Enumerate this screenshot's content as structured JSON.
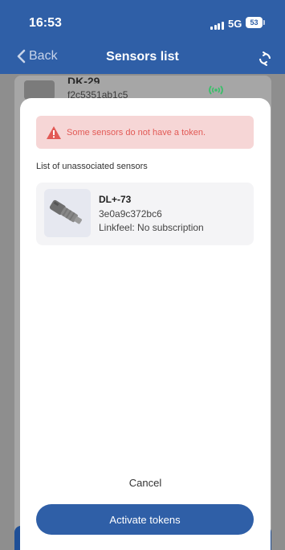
{
  "status_bar": {
    "time": "16:53",
    "network": "5G",
    "battery": "53"
  },
  "nav": {
    "back_label": "Back",
    "title": "Sensors list"
  },
  "background_item": {
    "name": "DK-29",
    "id": "f2c5351ab1c5"
  },
  "modal": {
    "alert_text": "Some sensors do not have a token.",
    "section_label": "List of unassociated sensors",
    "sensors": [
      {
        "name": "DL+-73",
        "id": "3e0a9c372bc6",
        "subscription": "Linkfeel: No subscription"
      }
    ],
    "cancel_label": "Cancel",
    "activate_label": "Activate tokens"
  },
  "colors": {
    "primary": "#2f5fa7",
    "alert_bg": "#f6d6d6",
    "alert_text": "#e25a56",
    "signal": "#3bbf6a"
  }
}
